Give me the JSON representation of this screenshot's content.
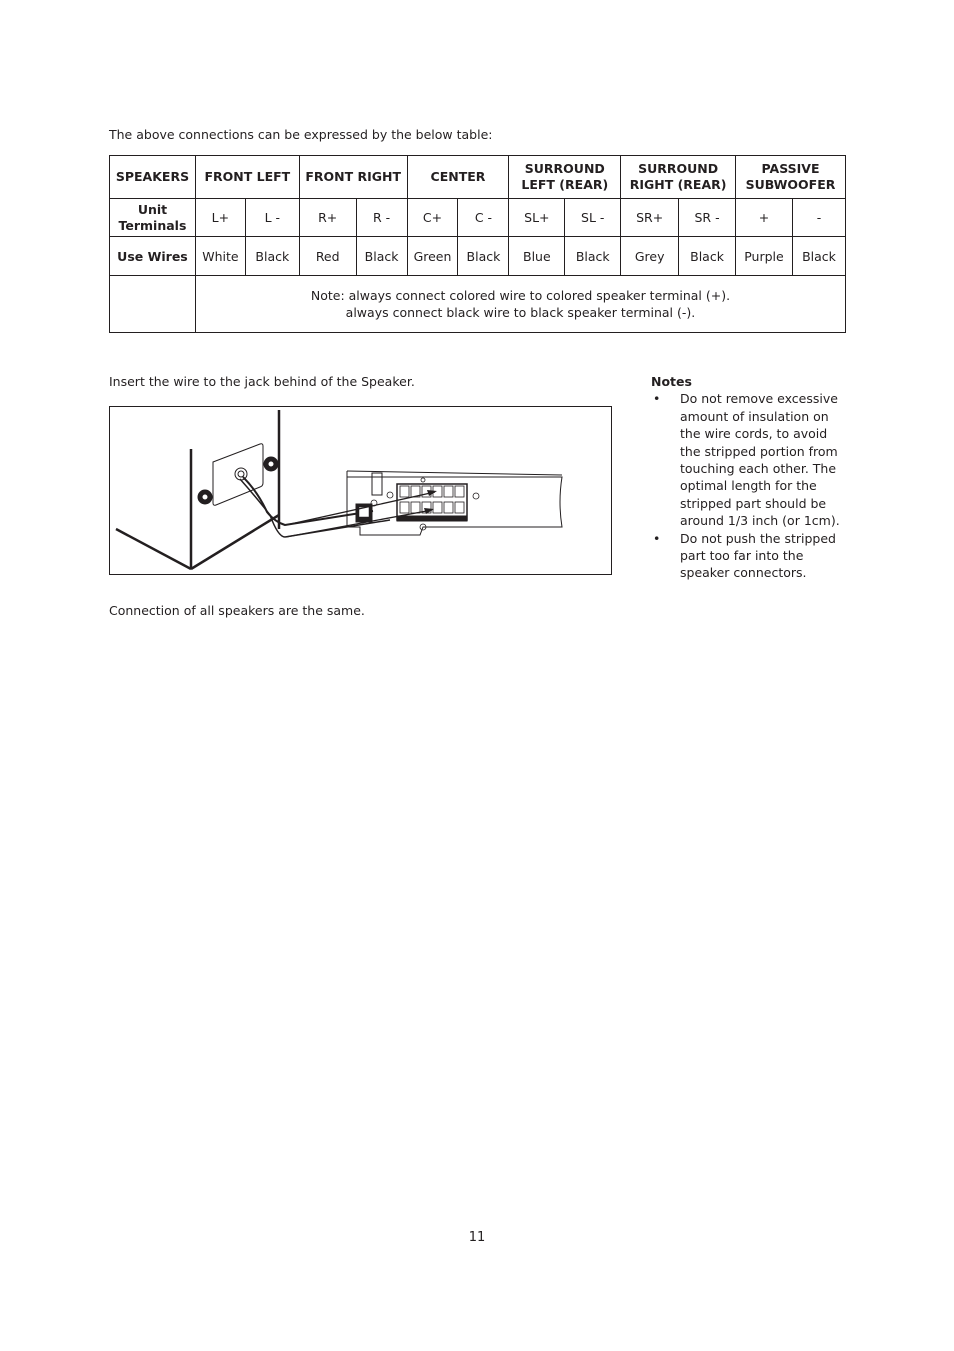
{
  "intro_text": "The above connections can be expressed by the below table:",
  "table": {
    "header": {
      "label": "SPEAKERS",
      "groups": [
        {
          "line1": "FRONT LEFT",
          "line2": ""
        },
        {
          "line1": "FRONT RIGHT",
          "line2": ""
        },
        {
          "line1": "CENTER",
          "line2": ""
        },
        {
          "line1": "SURROUND",
          "line2": "LEFT (REAR)"
        },
        {
          "line1": "SURROUND",
          "line2": "RIGHT (REAR)"
        },
        {
          "line1": "PASSIVE",
          "line2": "SUBWOOFER"
        }
      ]
    },
    "terminals_row": {
      "label_line1": "Unit",
      "label_line2": "Terminals",
      "values": [
        "L+",
        "L -",
        "R+",
        "R -",
        "C+",
        "C -",
        "SL+",
        "SL -",
        "SR+",
        "SR -",
        "+",
        "-"
      ]
    },
    "wires_row": {
      "label": "Use Wires",
      "values": [
        "White",
        "Black",
        "Red",
        "Black",
        "Green",
        "Black",
        "Blue",
        "Black",
        "Grey",
        "Black",
        "Purple",
        "Black"
      ]
    },
    "note_line1": "Note: always connect colored wire to colored speaker terminal (+).",
    "note_line2": "always connect black wire to black speaker terminal (-)."
  },
  "insert_text": "Insert the wire to the jack behind of the Speaker.",
  "diagram_label": "speaker-to-unit wiring illustration",
  "connection_text": "Connection of all speakers are the same.",
  "notes": {
    "title": "Notes",
    "bullet": "•",
    "items": [
      "Do not remove excessive amount of insulation on the wire cords, to avoid the stripped portion from touching each other. The optimal length for the stripped part should be around 1/3 inch (or 1cm).",
      "Do not push the stripped part too far into the speaker connectors."
    ]
  },
  "page_number": "11"
}
